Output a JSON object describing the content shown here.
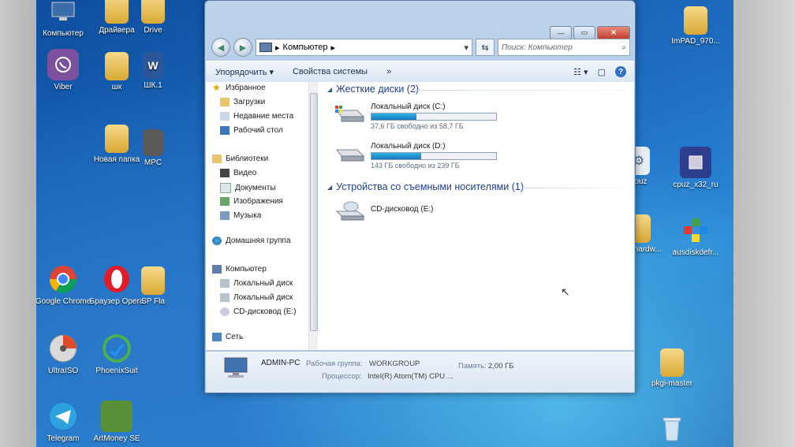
{
  "desktop": {
    "left_icons": [
      {
        "label": "Компьютер",
        "icon": "computer-icon"
      },
      {
        "label": "Драйвера",
        "icon": "folder-icon"
      },
      {
        "label": "Drive",
        "icon": "folder-icon"
      },
      {
        "label": "Viber",
        "icon": "viber-icon"
      },
      {
        "label": "шк",
        "icon": "folder-icon"
      },
      {
        "label": "ШК.1",
        "icon": "word-doc-icon"
      },
      {
        "label": "Новая папка",
        "icon": "folder-icon"
      },
      {
        "label": "MPC",
        "icon": "app-icon"
      },
      {
        "label": "Google Chrome",
        "icon": "chrome-icon"
      },
      {
        "label": "Браузер Opera",
        "icon": "opera-icon"
      },
      {
        "label": "SP Fla",
        "icon": "folder-icon"
      },
      {
        "label": "UltraISO",
        "icon": "disc-icon"
      },
      {
        "label": "PhoenixSuit",
        "icon": "phoenix-icon"
      },
      {
        "label": "Telegram",
        "icon": "telegram-icon"
      },
      {
        "label": "ArtMoney SE",
        "icon": "artmoney-icon"
      }
    ],
    "right_icons": [
      {
        "label": "ImPAD_970...",
        "icon": "folder-icon"
      },
      {
        "label": "cpuz",
        "icon": "gear-file-icon"
      },
      {
        "label": "cpuz_x32_ru",
        "icon": "cpu-icon"
      },
      {
        "label": "openhardw...",
        "icon": "folder-icon"
      },
      {
        "label": "ausdiskdefr...",
        "icon": "defrag-icon"
      },
      {
        "label": "pkgi-master",
        "icon": "folder-icon"
      },
      {
        "label": "",
        "icon": "recycle-bin-icon"
      }
    ]
  },
  "window": {
    "address": {
      "separator": "▸",
      "location": "Компьютер"
    },
    "search": {
      "placeholder": "Поиск: Компьютер"
    },
    "toolbar": {
      "organize": "Упорядочить",
      "system_properties": "Свойства системы",
      "more": "»"
    },
    "navpane": {
      "items": [
        {
          "label": "Избранное",
          "icon": "star-icon"
        },
        {
          "label": "Загрузки",
          "icon": "downloads-icon"
        },
        {
          "label": "Недавние места",
          "icon": "recent-places-icon"
        },
        {
          "label": "Рабочий стол",
          "icon": "desktop-icon"
        },
        {
          "label": "Библиотеки",
          "icon": "libraries-icon"
        },
        {
          "label": "Видео",
          "icon": "video-icon"
        },
        {
          "label": "Документы",
          "icon": "documents-icon"
        },
        {
          "label": "Изображения",
          "icon": "pictures-icon"
        },
        {
          "label": "Музыка",
          "icon": "music-icon"
        },
        {
          "label": "Домашняя группа",
          "icon": "homegroup-icon"
        },
        {
          "label": "Компьютер",
          "icon": "computer-icon"
        },
        {
          "label": "Локальный диск",
          "icon": "drive-icon"
        },
        {
          "label": "Локальный диск",
          "icon": "drive-icon"
        },
        {
          "label": "CD-дисковод (E:)",
          "icon": "cd-drive-icon"
        },
        {
          "label": "Сеть",
          "icon": "network-icon"
        }
      ]
    },
    "groups": {
      "hard_disks": "Жесткие диски (2)",
      "removable": "Устройства со съемными носителями (1)"
    },
    "drives": [
      {
        "name": "Локальный диск (C:)",
        "free_text": "37,6 ГБ свободно из 58,7 ГБ",
        "used_fraction": 0.36
      },
      {
        "name": "Локальный диск (D:)",
        "free_text": "143 ГБ свободно из 239 ГБ",
        "used_fraction": 0.4
      }
    ],
    "cd_drive": {
      "name": "CD-дисковод (E:)"
    },
    "details": {
      "pc_name": "ADMIN-PC",
      "workgroup_label": "Рабочая группа:",
      "workgroup_value": "WORKGROUP",
      "memory_label": "Память:",
      "memory_value": "2,00 ГБ",
      "cpu_label": "Процессор:",
      "cpu_value": "Intel(R) Atom(TM) CPU ..."
    }
  },
  "colors": {
    "accent": "#1e3f8c",
    "bar_fill": "#1a8fd0",
    "close_button": "#c2402e"
  }
}
